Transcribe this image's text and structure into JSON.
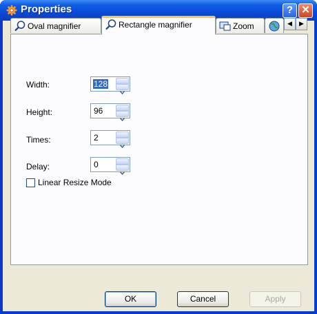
{
  "window": {
    "title": "Properties",
    "title_icon": "gear-icon",
    "help_label": "?",
    "close_label": "✕"
  },
  "tabs": [
    {
      "label": "Oval magnifier",
      "icon": "magnifier-icon",
      "selected": false
    },
    {
      "label": "Rectangle magnifier",
      "icon": "magnifier-icon",
      "selected": true
    },
    {
      "label": "Zoom",
      "icon": "zoom-icon",
      "selected": false
    },
    {
      "label": "",
      "icon": "globe-icon",
      "selected": false
    }
  ],
  "tab_scroll": {
    "left": "◀",
    "right": "▶"
  },
  "fields": {
    "width": {
      "label": "Width:",
      "value": "128"
    },
    "height": {
      "label": "Height:",
      "value": "96"
    },
    "times": {
      "label": "Times:",
      "value": "2"
    },
    "delay": {
      "label": "Delay:",
      "value": "0"
    }
  },
  "checkbox": {
    "label": "Linear Resize Mode",
    "checked": false
  },
  "buttons": {
    "ok": "OK",
    "cancel": "Cancel",
    "apply": "Apply"
  },
  "colors": {
    "title_bar": "#0a4bd6",
    "dialog_bg": "#ece9d8",
    "selection": "#316ac5",
    "close_button": "#c8462c",
    "tab_highlight": "#ffc83c"
  }
}
